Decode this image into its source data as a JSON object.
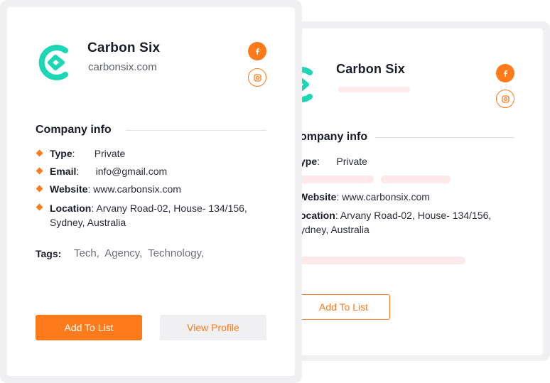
{
  "colors": {
    "accent": "#ff7a1a",
    "logo": "#1dd6b5",
    "skeleton": "#fde9e9"
  },
  "cards": {
    "front": {
      "company_name": "Carbon Six",
      "domain": "carbonsix.com",
      "social": [
        "facebook-icon",
        "instagram-icon"
      ],
      "section_title": "Company info",
      "type_label": "Type",
      "type_value": "Private",
      "email_label": "Email",
      "email_value": "info@gmail.com",
      "website_label": "Website",
      "website_value": "www.carbonsix.com",
      "location_label": "Location",
      "location_line1": "Arvany Road-02, House- 134/156,",
      "location_line2": "Sydney, Australia",
      "tags_label": "Tags:",
      "tags": "Tech,  Agency,  Technology,",
      "add_button": "Add To List",
      "view_button": "View Profile"
    },
    "back": {
      "company_name": "Carbon Six",
      "section_title": "ompany info",
      "type_label": "ype",
      "type_value": "Private",
      "website_label": "Website",
      "website_value": "www.carbonsix.com",
      "location_label": "ocation",
      "location_line1": "Arvany Road-02, House- 134/156,",
      "location_line2": "ydney, Australia",
      "add_button": "Add To List"
    }
  }
}
